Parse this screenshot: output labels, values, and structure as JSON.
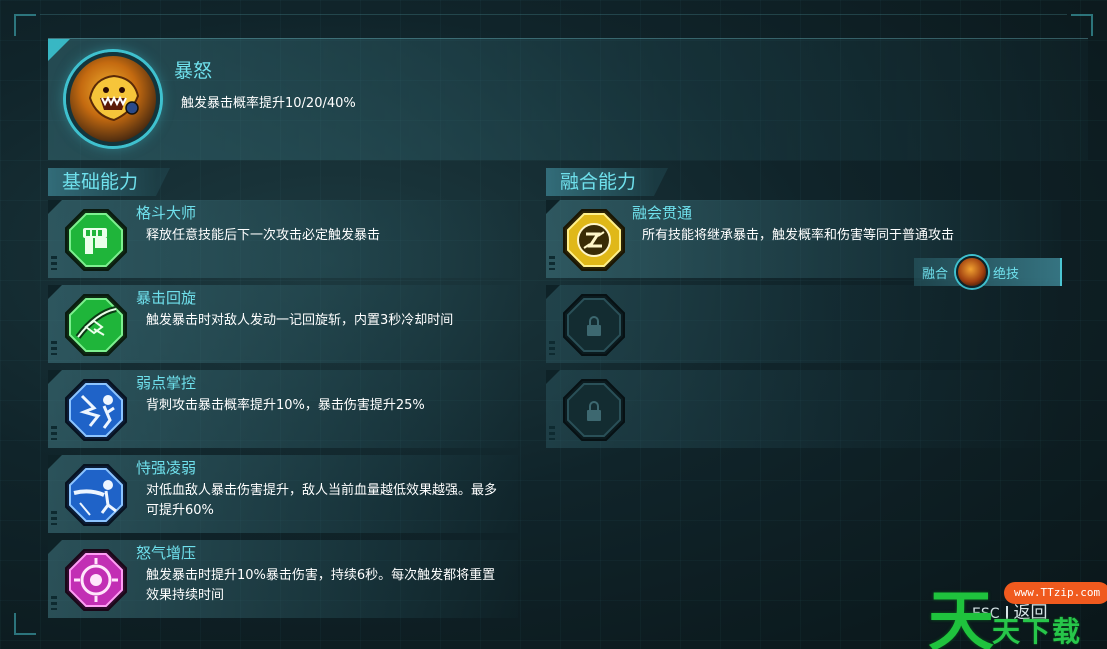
{
  "main_skill": {
    "title": "暴怒",
    "description": "触发暴击概率提升10/20/40%",
    "icon": "rage-beast-icon"
  },
  "sections": {
    "basic_label": "基础能力",
    "fusion_label": "融合能力"
  },
  "basic_skills": [
    {
      "title": "格斗大师",
      "description": "释放任意技能后下一次攻击必定触发暴击",
      "icon": "fist-icon",
      "color": "#27c34a"
    },
    {
      "title": "暴击回旋",
      "description": "触发暴击时对敌人发动一记回旋斩，内置3秒冷却时间",
      "icon": "spin-slash-icon",
      "color": "#27c34a"
    },
    {
      "title": "弱点掌控",
      "description": "背刺攻击暴击概率提升10%，暴击伤害提升25%",
      "icon": "backstab-icon",
      "color": "#2f7fe0"
    },
    {
      "title": "恃强凌弱",
      "description": "对低血敌人暴击伤害提升，敌人当前血量越低效果越强。最多可提升60%",
      "icon": "blade-strike-icon",
      "color": "#2f7fe0"
    },
    {
      "title": "怒气增压",
      "description": "触发暴击时提升10%暴击伤害，持续6秒。每次触发都将重置效果持续时间",
      "icon": "rage-core-icon",
      "color": "#d83fc8"
    }
  ],
  "fusion_skills": [
    {
      "title": "融会贯通",
      "description": "所有技能将继承暴击，触发概率和伤害等同于普通攻击",
      "icon": "fusion-swirl-icon",
      "color": "#f0c020"
    }
  ],
  "fusion_tag": {
    "prefix": "融合",
    "suffix": "绝技"
  },
  "footer": {
    "esc": "ESC",
    "back": "返回"
  },
  "watermark": {
    "big": "天",
    "url": "www.TTzip.com",
    "text": "天下载"
  }
}
